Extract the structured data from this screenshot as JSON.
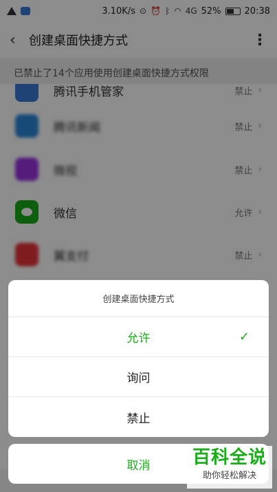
{
  "status_bar": {
    "speed": "3.10K/s",
    "battery": "52%",
    "time": "20:38",
    "network": "4G",
    "icons": [
      "warning-icon",
      "location-icon",
      "alarm-icon",
      "bluetooth-icon",
      "wifi-icon",
      "signal-icon",
      "battery-icon"
    ]
  },
  "header": {
    "back_icon": "‹",
    "title": "创建桌面快捷方式",
    "more_icon": "⋮"
  },
  "notice": "已禁止了14个应用使用创建桌面快捷方式权限",
  "apps": [
    {
      "name": "腾讯手机管家",
      "status": "禁止",
      "color": "#3b7bd8"
    },
    {
      "name": "腾讯新闻",
      "status": "禁止",
      "color": "#2a88d8"
    },
    {
      "name": "微视",
      "status": "禁止",
      "color": "#9b34e0"
    },
    {
      "name": "微信",
      "status": "允许",
      "color": "#1aad19"
    },
    {
      "name": "翼支付",
      "status": "禁止",
      "color": "#e8333a"
    }
  ],
  "sheet": {
    "title": "创建桌面快捷方式",
    "options": [
      {
        "label": "允许",
        "selected": true
      },
      {
        "label": "询问",
        "selected": false
      },
      {
        "label": "禁止",
        "selected": false
      }
    ],
    "check_icon": "✓",
    "cancel_label": "取消"
  },
  "watermark": {
    "main": "百科全说",
    "sub": "助你轻松解决"
  },
  "colors": {
    "accent": "#1aad19"
  }
}
